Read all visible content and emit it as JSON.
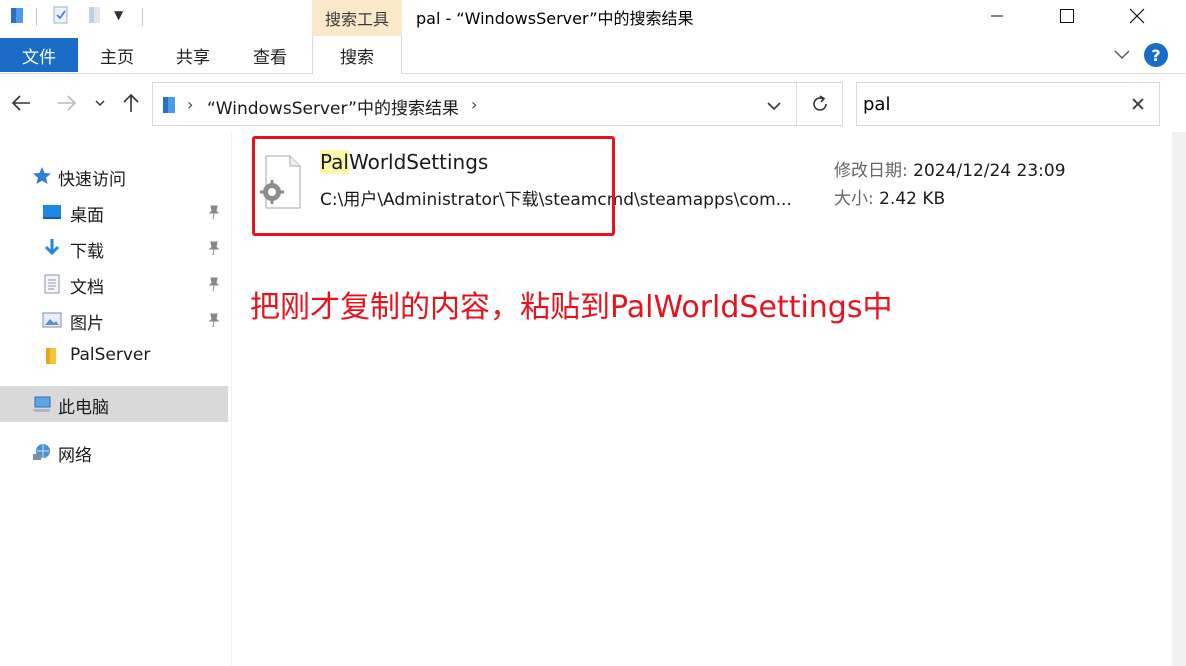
{
  "window": {
    "title": "pal - “WindowsServer”中的搜索结果",
    "context_tab": "搜索工具"
  },
  "ribbon": {
    "file": "文件",
    "home": "主页",
    "share": "共享",
    "view": "查看",
    "search": "搜索",
    "help": "?"
  },
  "address": {
    "path": "“WindowsServer”中的搜索结果",
    "separator": "›"
  },
  "search": {
    "value": "pal"
  },
  "sidebar": {
    "quick_access": "快速访问",
    "items": [
      {
        "label": "桌面",
        "icon": "desktop-icon",
        "pinned": true
      },
      {
        "label": "下载",
        "icon": "download-icon",
        "pinned": true
      },
      {
        "label": "文档",
        "icon": "document-icon",
        "pinned": true
      },
      {
        "label": "图片",
        "icon": "pictures-icon",
        "pinned": true
      },
      {
        "label": "PalServer",
        "icon": "folder-icon",
        "pinned": false
      }
    ],
    "this_pc": "此电脑",
    "network": "网络"
  },
  "result": {
    "name_highlight": "Pal",
    "name_rest": "WorldSettings",
    "path": "C:\\用户\\Administrator\\下载\\steamcmd\\steamapps\\com...",
    "date_label": "修改日期:",
    "date_value": "2024/12/24 23:09",
    "size_label": "大小:",
    "size_value": "2.42 KB"
  },
  "annotation": {
    "text": "把刚才复制的内容，粘贴到PalWorldSettings中",
    "color": "#e8121c"
  },
  "colors": {
    "accent": "#1a6cc7",
    "context_tab_bg": "#f9e9c9",
    "highlight": "#fff7a8"
  }
}
